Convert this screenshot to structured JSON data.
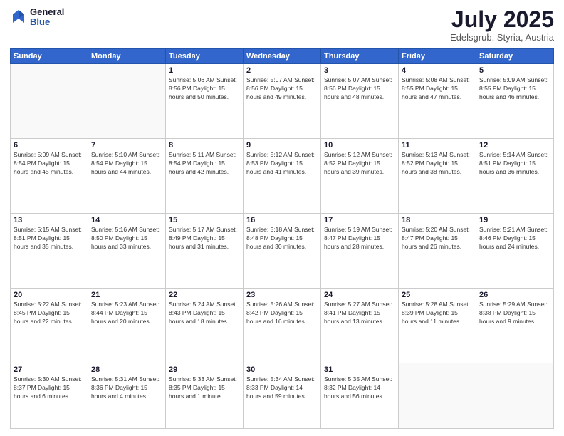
{
  "logo": {
    "general": "General",
    "blue": "Blue"
  },
  "header": {
    "month": "July 2025",
    "location": "Edelsgrub, Styria, Austria"
  },
  "days_of_week": [
    "Sunday",
    "Monday",
    "Tuesday",
    "Wednesday",
    "Thursday",
    "Friday",
    "Saturday"
  ],
  "weeks": [
    [
      {
        "day": "",
        "info": ""
      },
      {
        "day": "",
        "info": ""
      },
      {
        "day": "1",
        "info": "Sunrise: 5:06 AM\nSunset: 8:56 PM\nDaylight: 15 hours\nand 50 minutes."
      },
      {
        "day": "2",
        "info": "Sunrise: 5:07 AM\nSunset: 8:56 PM\nDaylight: 15 hours\nand 49 minutes."
      },
      {
        "day": "3",
        "info": "Sunrise: 5:07 AM\nSunset: 8:56 PM\nDaylight: 15 hours\nand 48 minutes."
      },
      {
        "day": "4",
        "info": "Sunrise: 5:08 AM\nSunset: 8:55 PM\nDaylight: 15 hours\nand 47 minutes."
      },
      {
        "day": "5",
        "info": "Sunrise: 5:09 AM\nSunset: 8:55 PM\nDaylight: 15 hours\nand 46 minutes."
      }
    ],
    [
      {
        "day": "6",
        "info": "Sunrise: 5:09 AM\nSunset: 8:54 PM\nDaylight: 15 hours\nand 45 minutes."
      },
      {
        "day": "7",
        "info": "Sunrise: 5:10 AM\nSunset: 8:54 PM\nDaylight: 15 hours\nand 44 minutes."
      },
      {
        "day": "8",
        "info": "Sunrise: 5:11 AM\nSunset: 8:54 PM\nDaylight: 15 hours\nand 42 minutes."
      },
      {
        "day": "9",
        "info": "Sunrise: 5:12 AM\nSunset: 8:53 PM\nDaylight: 15 hours\nand 41 minutes."
      },
      {
        "day": "10",
        "info": "Sunrise: 5:12 AM\nSunset: 8:52 PM\nDaylight: 15 hours\nand 39 minutes."
      },
      {
        "day": "11",
        "info": "Sunrise: 5:13 AM\nSunset: 8:52 PM\nDaylight: 15 hours\nand 38 minutes."
      },
      {
        "day": "12",
        "info": "Sunrise: 5:14 AM\nSunset: 8:51 PM\nDaylight: 15 hours\nand 36 minutes."
      }
    ],
    [
      {
        "day": "13",
        "info": "Sunrise: 5:15 AM\nSunset: 8:51 PM\nDaylight: 15 hours\nand 35 minutes."
      },
      {
        "day": "14",
        "info": "Sunrise: 5:16 AM\nSunset: 8:50 PM\nDaylight: 15 hours\nand 33 minutes."
      },
      {
        "day": "15",
        "info": "Sunrise: 5:17 AM\nSunset: 8:49 PM\nDaylight: 15 hours\nand 31 minutes."
      },
      {
        "day": "16",
        "info": "Sunrise: 5:18 AM\nSunset: 8:48 PM\nDaylight: 15 hours\nand 30 minutes."
      },
      {
        "day": "17",
        "info": "Sunrise: 5:19 AM\nSunset: 8:47 PM\nDaylight: 15 hours\nand 28 minutes."
      },
      {
        "day": "18",
        "info": "Sunrise: 5:20 AM\nSunset: 8:47 PM\nDaylight: 15 hours\nand 26 minutes."
      },
      {
        "day": "19",
        "info": "Sunrise: 5:21 AM\nSunset: 8:46 PM\nDaylight: 15 hours\nand 24 minutes."
      }
    ],
    [
      {
        "day": "20",
        "info": "Sunrise: 5:22 AM\nSunset: 8:45 PM\nDaylight: 15 hours\nand 22 minutes."
      },
      {
        "day": "21",
        "info": "Sunrise: 5:23 AM\nSunset: 8:44 PM\nDaylight: 15 hours\nand 20 minutes."
      },
      {
        "day": "22",
        "info": "Sunrise: 5:24 AM\nSunset: 8:43 PM\nDaylight: 15 hours\nand 18 minutes."
      },
      {
        "day": "23",
        "info": "Sunrise: 5:26 AM\nSunset: 8:42 PM\nDaylight: 15 hours\nand 16 minutes."
      },
      {
        "day": "24",
        "info": "Sunrise: 5:27 AM\nSunset: 8:41 PM\nDaylight: 15 hours\nand 13 minutes."
      },
      {
        "day": "25",
        "info": "Sunrise: 5:28 AM\nSunset: 8:39 PM\nDaylight: 15 hours\nand 11 minutes."
      },
      {
        "day": "26",
        "info": "Sunrise: 5:29 AM\nSunset: 8:38 PM\nDaylight: 15 hours\nand 9 minutes."
      }
    ],
    [
      {
        "day": "27",
        "info": "Sunrise: 5:30 AM\nSunset: 8:37 PM\nDaylight: 15 hours\nand 6 minutes."
      },
      {
        "day": "28",
        "info": "Sunrise: 5:31 AM\nSunset: 8:36 PM\nDaylight: 15 hours\nand 4 minutes."
      },
      {
        "day": "29",
        "info": "Sunrise: 5:33 AM\nSunset: 8:35 PM\nDaylight: 15 hours\nand 1 minute."
      },
      {
        "day": "30",
        "info": "Sunrise: 5:34 AM\nSunset: 8:33 PM\nDaylight: 14 hours\nand 59 minutes."
      },
      {
        "day": "31",
        "info": "Sunrise: 5:35 AM\nSunset: 8:32 PM\nDaylight: 14 hours\nand 56 minutes."
      },
      {
        "day": "",
        "info": ""
      },
      {
        "day": "",
        "info": ""
      }
    ]
  ]
}
